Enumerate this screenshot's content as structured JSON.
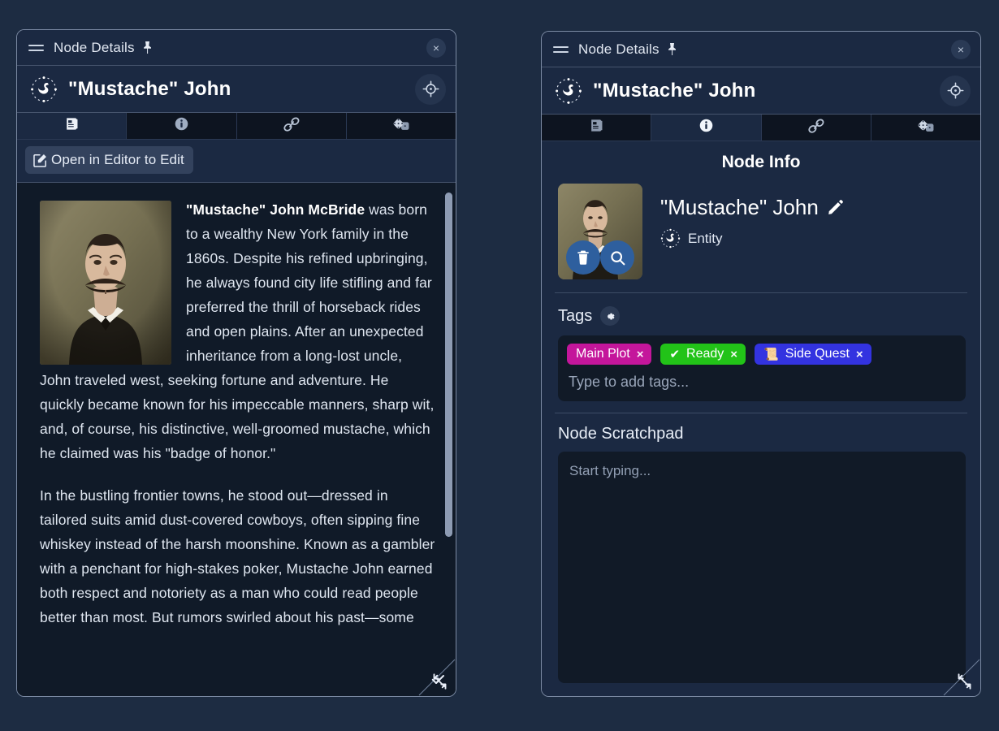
{
  "app": {
    "background_color": "#1d2c42",
    "panel_color": "#1b2942",
    "content_color": "#101a28"
  },
  "left_panel": {
    "titlebar": {
      "title": "Node Details",
      "drag_handle_icon": "hamburger-drag-icon",
      "pin_icon": "pin-icon",
      "close_label": "×"
    },
    "node_header": {
      "icon": "swan-constellation-icon",
      "title": "\"Mustache\" John",
      "locate_icon": "crosshair-target-icon"
    },
    "tabs": [
      {
        "id": "document",
        "icon": "document-book-icon",
        "active": true
      },
      {
        "id": "info",
        "icon": "info-circle-icon",
        "active": false
      },
      {
        "id": "links",
        "icon": "link-chain-icon",
        "active": false
      },
      {
        "id": "dice",
        "icon": "dice-icon",
        "active": false
      }
    ],
    "toolbar": {
      "open_editor_label": "Open in Editor to Edit",
      "open_editor_icon": "pencil-square-icon"
    },
    "document": {
      "portrait_alt": "portrait-of-mustached-victorian-man",
      "paragraphs": [
        {
          "lead": "\"Mustache\" John McBride",
          "text": " was born to a wealthy New York family in the 1860s. Despite his refined upbringing, he always found city life stifling and far preferred the thrill of horseback rides and open plains. After an unexpected inheritance from a long-lost uncle, John traveled west, seeking fortune and adventure. He quickly became known for his impeccable manners, sharp wit, and, of course, his distinctive, well-groomed mustache, which he claimed was his \"badge of honor.\""
        },
        {
          "lead": "",
          "text": "In the bustling frontier towns, he stood out—dressed in tailored suits amid dust-covered cowboys, often sipping fine whiskey instead of the harsh moonshine. Known as a gambler with a penchant for high-stakes poker, Mustache John earned both respect and notoriety as a man who could read people better than most. But rumors swirled about his past—some"
        }
      ],
      "scrollbar_visible": true
    },
    "resize_icon": "diagonal-resize-icon"
  },
  "right_panel": {
    "titlebar": {
      "title": "Node Details",
      "drag_handle_icon": "hamburger-drag-icon",
      "pin_icon": "pin-icon",
      "close_label": "×"
    },
    "node_header": {
      "icon": "swan-constellation-icon",
      "title": "\"Mustache\" John",
      "locate_icon": "crosshair-target-icon"
    },
    "tabs": [
      {
        "id": "document",
        "icon": "document-book-icon",
        "active": false
      },
      {
        "id": "info",
        "icon": "info-circle-icon",
        "active": true
      },
      {
        "id": "links",
        "icon": "link-chain-icon",
        "active": false
      },
      {
        "id": "dice",
        "icon": "dice-icon",
        "active": false
      }
    ],
    "info": {
      "heading": "Node Info",
      "thumbnail_alt": "portrait-thumbnail",
      "delete_icon": "trash-icon",
      "zoom_icon": "magnifier-icon",
      "name": "\"Mustache\" John",
      "edit_icon": "pencil-icon",
      "type_icon": "swan-constellation-icon",
      "type_label": "Entity"
    },
    "tags": {
      "title": "Tags",
      "settings_icon": "gear-icon",
      "items": [
        {
          "label": "Main Plot",
          "color": "#c4169b",
          "glyph": "",
          "remove_label": "×"
        },
        {
          "label": "Ready",
          "color": "#22c318",
          "glyph": "✔",
          "remove_label": "×"
        },
        {
          "label": "Side Quest",
          "color": "#3333e0",
          "glyph": "📜",
          "remove_label": "×"
        }
      ],
      "input_value": "",
      "input_placeholder": "Type to add tags..."
    },
    "scratchpad": {
      "title": "Node Scratchpad",
      "value": "",
      "placeholder": "Start typing..."
    },
    "resize_icon": "diagonal-resize-icon"
  }
}
